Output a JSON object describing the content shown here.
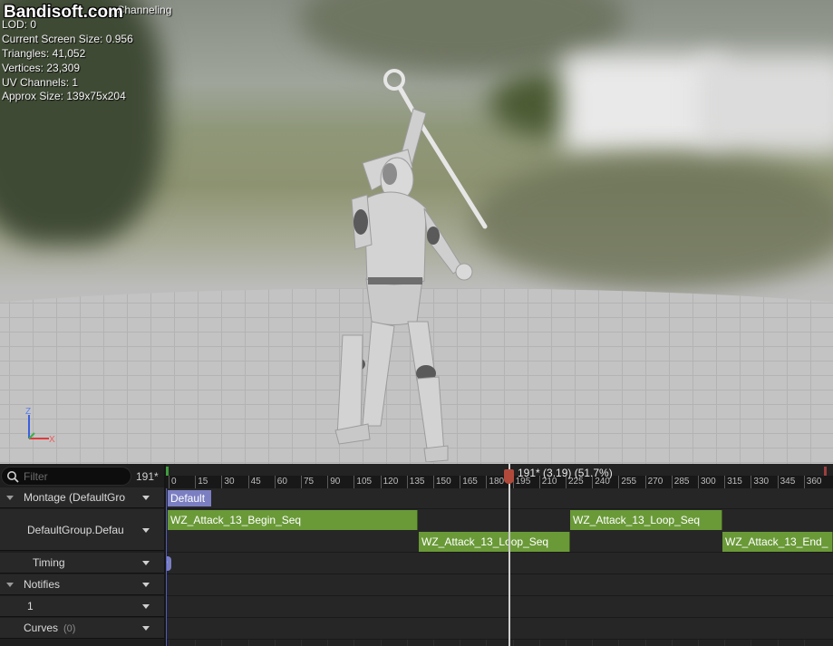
{
  "watermark": "Bandisoft.com",
  "viewport_stats": {
    "title": "AM_Attack_13_Channeling",
    "title_visible": "_Channeling",
    "lod": "LOD: 0",
    "screen_size": "Current Screen Size: 0.956",
    "triangles": "Triangles: 41,052",
    "vertices": "Vertices: 23,309",
    "uv_channels": "UV Channels: 1",
    "approx_size": "Approx Size: 139x75x204"
  },
  "axis_gizmo": {
    "z": "Z",
    "x": "X"
  },
  "track_panel": {
    "filter_placeholder": "Filter",
    "frame_count": "191*",
    "rows": {
      "montage": "Montage (DefaultGro",
      "default_group": "DefaultGroup.Defau",
      "timing": "Timing",
      "notifies": "Notifies",
      "notify_track": "1",
      "curves": "Curves",
      "curves_count": "(0)"
    }
  },
  "timeline": {
    "ruler_labels": [
      "0",
      "15",
      "30",
      "45",
      "60",
      "75",
      "90",
      "105",
      "120",
      "135",
      "150",
      "165",
      "180",
      "195",
      "210",
      "225",
      "240",
      "255",
      "270",
      "285",
      "300",
      "315",
      "330",
      "345",
      "360"
    ],
    "playhead_label": "191* (3.19) (51.7%)",
    "slot_label": "Default",
    "timing_marker": "0",
    "segments": {
      "begin": "WZ_Attack_13_Begin_Seq",
      "loop1": "WZ_Attack_13_Loop_Seq",
      "loop2": "WZ_Attack_13_Loop_Seq",
      "end": "WZ_Attack_13_End_"
    }
  },
  "colors": {
    "segment": "#6a9a38",
    "slot": "#7b7fc2",
    "playhead": "#b24a3c"
  }
}
